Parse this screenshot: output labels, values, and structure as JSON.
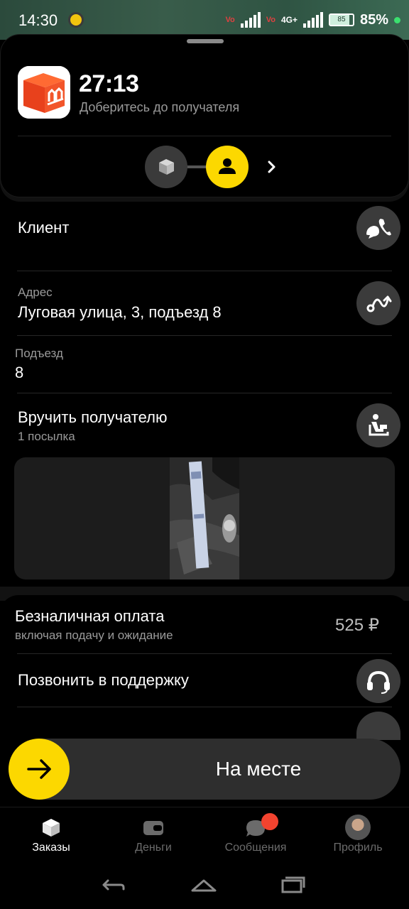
{
  "status_bar": {
    "time": "14:30",
    "network": "4G+",
    "battery_level": "85",
    "battery_percent": "85%"
  },
  "order": {
    "timer": "27:13",
    "subtitle": "Доберитесь до получателя",
    "steps": [
      "package-icon",
      "person-icon"
    ]
  },
  "client": {
    "label": "Клиент"
  },
  "address": {
    "label": "Адрес",
    "value": "Луговая улица, 3, подъезд 8"
  },
  "entrance": {
    "label": "Подъезд",
    "value": "8"
  },
  "delivery": {
    "title": "Вручить получателю",
    "count": "1 посылка"
  },
  "payment": {
    "title": "Безналичная оплата",
    "note": "включая подачу и ожидание",
    "price": "525 ₽"
  },
  "support": {
    "label": "Позвонить в поддержку"
  },
  "action": {
    "label": "На месте"
  },
  "nav": {
    "items": [
      {
        "label": "Заказы",
        "icon": "cube-icon",
        "active": true
      },
      {
        "label": "Деньги",
        "icon": "wallet-icon",
        "active": false
      },
      {
        "label": "Сообщения",
        "icon": "chat-icon",
        "active": false
      },
      {
        "label": "Профиль",
        "icon": "avatar",
        "active": false
      }
    ]
  },
  "colors": {
    "accent": "#fcd800",
    "background": "#000000",
    "button_bg": "#3b3b3b",
    "notification": "#f2432f"
  }
}
